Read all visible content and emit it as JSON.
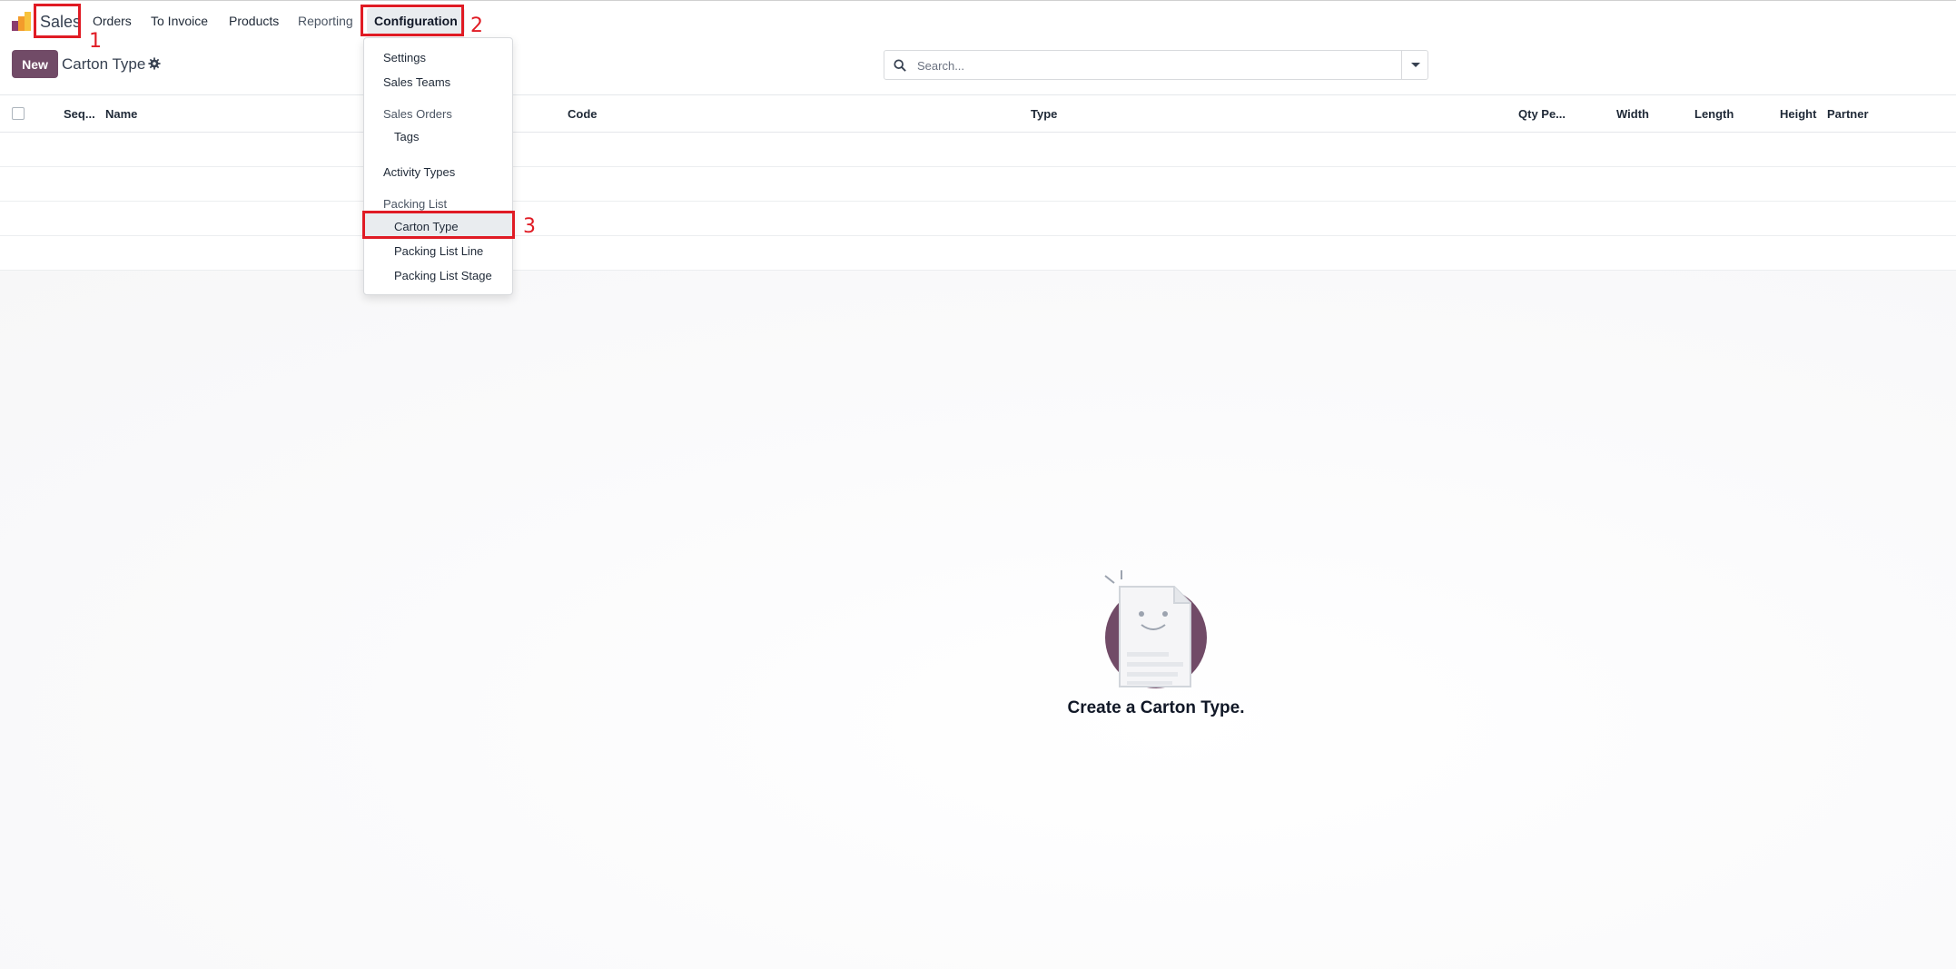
{
  "nav": {
    "app_name": "Sales",
    "items": [
      "Orders",
      "To Invoice",
      "Products",
      "Reporting",
      "Configuration"
    ]
  },
  "control_panel": {
    "new_label": "New",
    "breadcrumb": "Carton Type",
    "search_placeholder": "Search..."
  },
  "table": {
    "columns": [
      "Seq...",
      "Name",
      "Code",
      "Type",
      "Qty Pe...",
      "Width",
      "Length",
      "Height",
      "Partner"
    ]
  },
  "empty_state": {
    "title": "Create a Carton Type."
  },
  "config_menu": {
    "items": [
      {
        "label": "Settings",
        "kind": "item"
      },
      {
        "label": "Sales Teams",
        "kind": "item"
      },
      {
        "label": "Sales Orders",
        "kind": "section"
      },
      {
        "label": "Tags",
        "kind": "subitem"
      },
      {
        "label": "Activity Types",
        "kind": "item"
      },
      {
        "label": "Packing List",
        "kind": "section"
      },
      {
        "label": "Carton Type",
        "kind": "subitem",
        "active": true
      },
      {
        "label": "Packing List Line",
        "kind": "subitem"
      },
      {
        "label": "Packing List Stage",
        "kind": "subitem"
      }
    ]
  },
  "annotations": [
    "1",
    "2",
    "3"
  ],
  "colors": {
    "brand": "#714b67",
    "annotation": "#e01b24"
  },
  "icons": [
    "sales-app-logo-icon",
    "gear-icon",
    "search-icon",
    "caret-down-icon",
    "empty-document-icon"
  ]
}
